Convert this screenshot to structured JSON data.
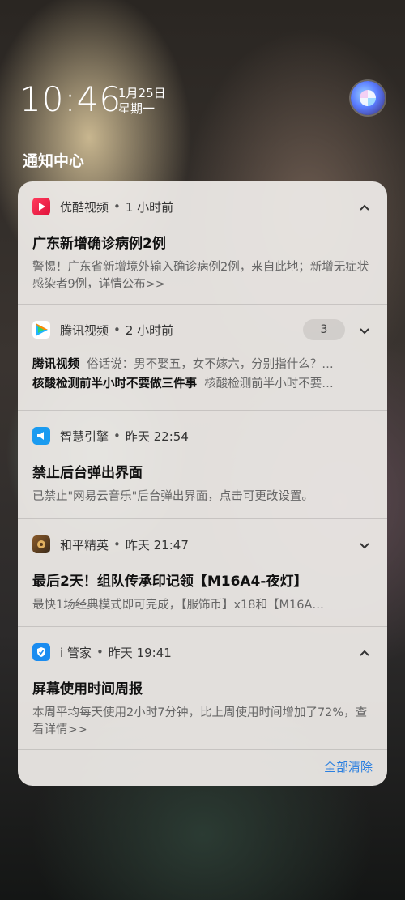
{
  "status": {
    "time": "10:46",
    "date": "1月25日",
    "weekday": "星期一"
  },
  "header": {
    "title": "通知中心"
  },
  "notifications": [
    {
      "app": "优酷视频",
      "time": "1 小时前",
      "title": "广东新增确诊病例2例",
      "body": "警惕！广东省新增境外输入确诊病例2例，来自此地；新增无症状感染者9例，详情公布>>",
      "icon": "youku-icon",
      "chevron": "chevron-up-icon"
    },
    {
      "app": "腾讯视频",
      "time": "2 小时前",
      "count": "3",
      "rows": [
        {
          "bold": "腾讯视频",
          "text": "俗话说：男不娶五，女不嫁六，分别指什么？…"
        },
        {
          "bold": "核酸检测前半小时不要做三件事",
          "text": "核酸检测前半小时不要…"
        }
      ],
      "icon": "tencent-video-icon",
      "chevron": "chevron-down-icon"
    },
    {
      "app": "智慧引擎",
      "time": "昨天 22:54",
      "title": "禁止后台弹出界面",
      "body": "已禁止\"网易云音乐\"后台弹出界面，点击可更改设置。",
      "icon": "smart-engine-icon"
    },
    {
      "app": "和平精英",
      "time": "昨天 21:47",
      "title": "最后2天！组队传承印记领【M16A4-夜灯】",
      "body": "最快1场经典模式即可完成，【服饰币】x18和【M16A…",
      "icon": "pubg-icon",
      "chevron": "chevron-down-icon"
    },
    {
      "app": "i 管家",
      "time": "昨天 19:41",
      "title": "屏幕使用时间周报",
      "body": "本周平均每天使用2小时7分钟，比上周使用时间增加了72%，查看详情>>",
      "icon": "shield-icon",
      "chevron": "chevron-up-icon"
    }
  ],
  "footer": {
    "clear_all": "全部清除"
  },
  "colors": {
    "accent": "#2a7fe0"
  }
}
